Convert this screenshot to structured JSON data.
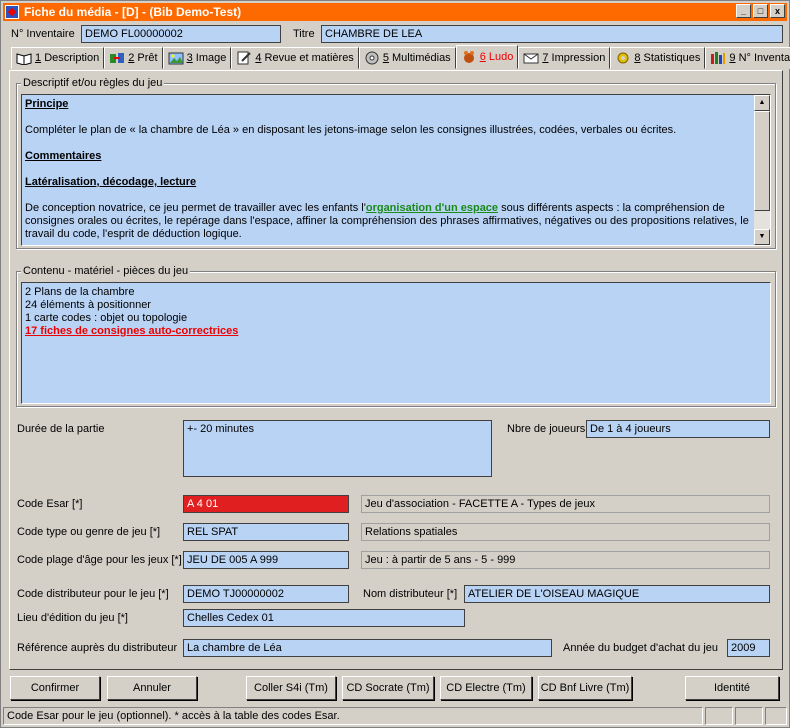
{
  "window": {
    "title": "Fiche du média - [D] - (Bib Demo-Test)",
    "controls": [
      "_",
      "□",
      "x"
    ]
  },
  "header": {
    "inventaire_label": "N° Inventaire",
    "inventaire_value": "DEMO FL00000002",
    "titre_label": "Titre",
    "titre_value": "CHAMBRE DE LEA"
  },
  "tabs": [
    {
      "key": "1",
      "label": "Description"
    },
    {
      "key": "2",
      "label": "Prêt"
    },
    {
      "key": "3",
      "label": "Image"
    },
    {
      "key": "4",
      "label": "Revue et matières"
    },
    {
      "key": "5",
      "label": "Multimédias"
    },
    {
      "key": "6",
      "label": "Ludo"
    },
    {
      "key": "7",
      "label": "Impression"
    },
    {
      "key": "8",
      "label": "Statistiques"
    },
    {
      "key": "9",
      "label": "N° Inventaire"
    }
  ],
  "descriptif": {
    "group_title": "Descriptif et/ou règles du jeu",
    "principe_heading": "Principe",
    "principe_text": "Compléter le plan de « la chambre de Léa » en disposant les jetons-image selon les consignes illustrées, codées, verbales ou écrites.",
    "commentaires_heading": "Commentaires",
    "lateralisation_heading": "Latéralisation, décodage, lecture",
    "conception_before": "De conception novatrice, ce jeu permet de travailler avec les enfants l'",
    "conception_highlight": "organisation d'un espace",
    "conception_after": " sous différents aspects : la compréhension de consignes orales ou écrites, le repérage dans l'espace, affiner la compréhension des phrases affirmatives, négatives ou des propositions relatives, le travail du code, l'esprit de déduction logique."
  },
  "contenu": {
    "group_title": "Contenu - matériel - pièces du jeu",
    "lines": [
      "2 Plans de la chambre",
      "24 éléments à positionner",
      "1 carte codes : objet ou topologie"
    ],
    "highlight_line": "17 fiches de consignes auto-correctrices"
  },
  "form": {
    "duree_label": "Durée de la partie",
    "duree_value": "+- 20 minutes",
    "joueurs_label": "Nbre de joueurs",
    "joueurs_value": "De 1 à 4 joueurs",
    "esar_label": "Code Esar [*]",
    "esar_value": "A 4 01",
    "esar_desc": "Jeu d'association - FACETTE A - Types de jeux",
    "type_label": "Code type ou genre de jeu [*]",
    "type_value": "REL SPAT",
    "type_desc": "Relations spatiales",
    "age_label": "Code plage d'âge pour les jeux [*]",
    "age_value": "JEU DE 005 A 999",
    "age_desc": "Jeu : à partir de 5 ans - 5 - 999",
    "distrib_label": "Code distributeur pour le jeu [*]",
    "distrib_value": "DEMO TJ00000002",
    "nom_distrib_label": "Nom distributeur [*]",
    "nom_distrib_value": "ATELIER DE L'OISEAU MAGIQUE",
    "lieu_label": "Lieu d'édition du jeu [*]",
    "lieu_value": "Chelles Cedex 01",
    "ref_label": "Référence auprès du distributeur",
    "ref_value": "La chambre de Léa",
    "annee_label": "Année du budget d'achat du jeu",
    "annee_value": "2009"
  },
  "buttons": {
    "confirmer": "Confirmer",
    "annuler": "Annuler",
    "coller": "Coller S4i (Tm)",
    "socrate": "CD Socrate (Tm)",
    "electre": "CD Electre (Tm)",
    "bnf": "CD Bnf Livre (Tm)",
    "identite": "Identité"
  },
  "status": {
    "text": "Code Esar pour le jeu (optionnel). * accès à la table des codes Esar."
  }
}
